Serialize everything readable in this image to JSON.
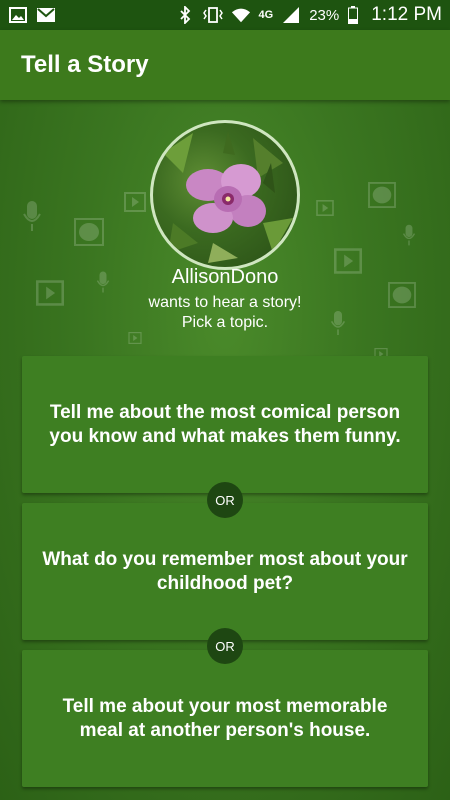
{
  "status_bar": {
    "icons_left": [
      "image-icon",
      "mail-icon"
    ],
    "icons_right": [
      "bluetooth-icon",
      "vibrate-icon",
      "wifi-icon",
      "lte-icon",
      "signal-icon",
      "battery-icon"
    ],
    "network": "4G",
    "battery": "23%",
    "time": "1:12 PM"
  },
  "app_bar": {
    "title": "Tell a Story"
  },
  "profile": {
    "name": "AllisonDono",
    "subtitle_line1": "wants to hear a story!",
    "subtitle_line2": "Pick a topic."
  },
  "topics": [
    {
      "text": "Tell me about the most comical person you know and what makes them funny."
    },
    {
      "text": "What do you remember most about your childhood pet?"
    },
    {
      "text": "Tell me about your most memorable meal at another person's house."
    }
  ],
  "or_label": "OR",
  "colors": {
    "status_bar": "#1e5410",
    "app_bar": "#3d7a1c",
    "card": "#3e7f22",
    "or_badge": "#1e4712"
  }
}
